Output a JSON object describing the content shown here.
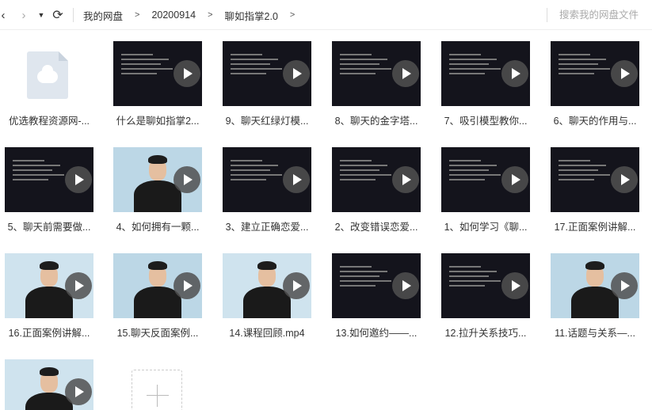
{
  "toolbar": {
    "breadcrumb": [
      "我的网盘",
      "20200914",
      "聊如指掌2.0"
    ],
    "search_placeholder": "搜索我的网盘文件"
  },
  "files": [
    {
      "name": "优选教程资源网-...",
      "kind": "file"
    },
    {
      "name": "什么是聊如指掌2...",
      "kind": "video"
    },
    {
      "name": "9、聊天红绿灯模...",
      "kind": "video"
    },
    {
      "name": "8、聊天的金字塔...",
      "kind": "video"
    },
    {
      "name": "7、吸引模型教你...",
      "kind": "video"
    },
    {
      "name": "6、聊天的作用与...",
      "kind": "video"
    },
    {
      "name": "5、聊天前需要做...",
      "kind": "video"
    },
    {
      "name": "4、如何拥有一颗...",
      "kind": "video"
    },
    {
      "name": "3、建立正确恋爱...",
      "kind": "video"
    },
    {
      "name": "2、改变错误恋爱...",
      "kind": "video"
    },
    {
      "name": "1、如何学习《聊...",
      "kind": "video"
    },
    {
      "name": "17.正面案例讲解...",
      "kind": "video"
    },
    {
      "name": "16.正面案例讲解...",
      "kind": "video"
    },
    {
      "name": "15.聊天反面案例...",
      "kind": "video"
    },
    {
      "name": "14.课程回顾.mp4",
      "kind": "video"
    },
    {
      "name": "13.如何邀约——...",
      "kind": "video"
    },
    {
      "name": "12.拉升关系技巧...",
      "kind": "video"
    },
    {
      "name": "11.话题与关系—...",
      "kind": "video"
    },
    {
      "name": "",
      "kind": "video"
    }
  ],
  "icons": {
    "back": "chevron-left-icon",
    "forward": "chevron-right-icon",
    "dropdown": "caret-down-icon",
    "refresh": "refresh-icon",
    "upload": "plus-icon"
  }
}
